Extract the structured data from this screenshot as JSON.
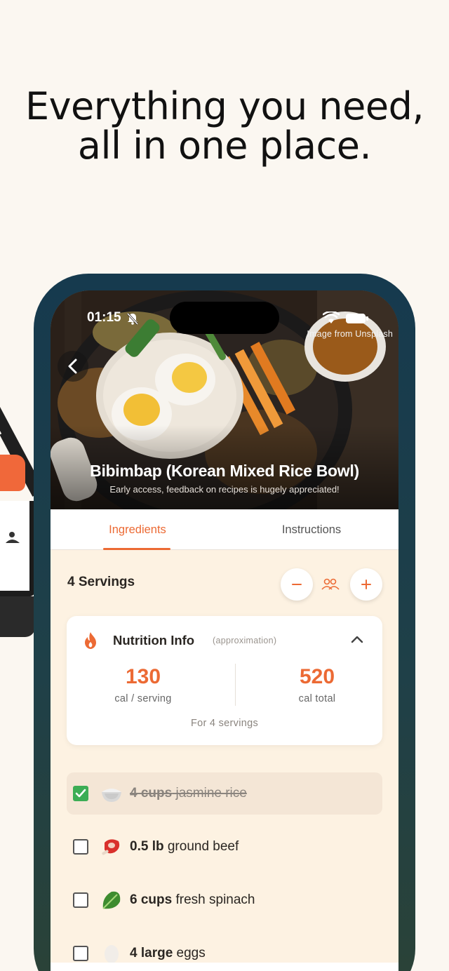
{
  "headline": {
    "line1": "Everything you need,",
    "line2": "all in one place."
  },
  "status_bar": {
    "time": "01:15"
  },
  "hero": {
    "credit": "Image from Unsplash",
    "title": "Bibimbap (Korean Mixed Rice Bowl)",
    "subtitle": "Early access, feedback on recipes is hugely appreciated!"
  },
  "tabs": [
    {
      "label": "Ingredients",
      "active": true
    },
    {
      "label": "Instructions",
      "active": false
    }
  ],
  "servings": {
    "label": "4 Servings"
  },
  "nutrition": {
    "title": "Nutrition Info",
    "note": "(approximation)",
    "per_serving_value": "130",
    "per_serving_label": "cal / serving",
    "total_value": "520",
    "total_label": "cal total",
    "footer": "For 4 servings"
  },
  "ingredients": [
    {
      "qty": "4 cups",
      "name": "jasmine rice",
      "icon": "rice-icon",
      "checked": true
    },
    {
      "qty": "0.5 lb",
      "name": "ground beef",
      "icon": "meat-icon",
      "checked": false
    },
    {
      "qty": "6 cups",
      "name": "fresh spinach",
      "icon": "spinach-icon",
      "checked": false
    },
    {
      "qty": "4 large",
      "name": "eggs",
      "icon": "egg-icon",
      "checked": false
    }
  ],
  "colors": {
    "accent": "#ec6a34",
    "check": "#3cad55",
    "frame": "#18384a",
    "background": "#fbf7f1"
  }
}
